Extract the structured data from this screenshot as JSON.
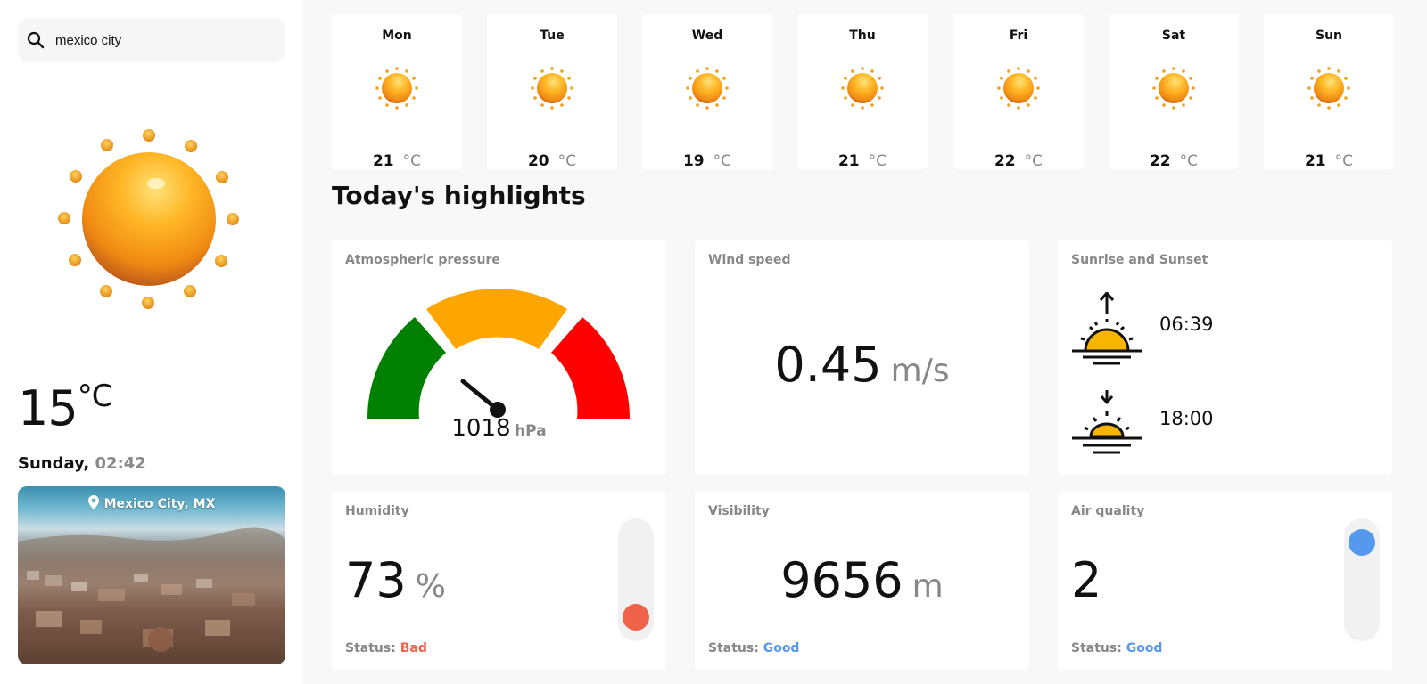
{
  "search": {
    "value": "mexico city",
    "icon": "search-icon"
  },
  "current": {
    "temperature": "15",
    "unit": "°C",
    "day": "Sunday,",
    "time": "02:42",
    "location": "Mexico City, MX",
    "icon": "sun-icon"
  },
  "forecast": [
    {
      "day": "Mon",
      "temp": "21",
      "unit": "°C",
      "icon": "sun-icon"
    },
    {
      "day": "Tue",
      "temp": "20",
      "unit": "°C",
      "icon": "sun-icon"
    },
    {
      "day": "Wed",
      "temp": "19",
      "unit": "°C",
      "icon": "sun-icon"
    },
    {
      "day": "Thu",
      "temp": "21",
      "unit": "°C",
      "icon": "sun-icon"
    },
    {
      "day": "Fri",
      "temp": "22",
      "unit": "°C",
      "icon": "sun-icon"
    },
    {
      "day": "Sat",
      "temp": "22",
      "unit": "°C",
      "icon": "sun-icon"
    },
    {
      "day": "Sun",
      "temp": "21",
      "unit": "°C",
      "icon": "sun-icon"
    }
  ],
  "highlights": {
    "title": "Today's highlights",
    "pressure": {
      "label": "Atmospheric pressure",
      "value": "1018",
      "unit": "hPa",
      "colors": [
        "#008000",
        "#ffa500",
        "#ff0000"
      ]
    },
    "wind": {
      "label": "Wind speed",
      "value": "0.45",
      "unit": "m/s"
    },
    "sun": {
      "label": "Sunrise and Sunset",
      "sunrise": "06:39",
      "sunset": "18:00",
      "sunrise_icon": "sunrise-icon",
      "sunset_icon": "sunset-icon"
    },
    "humidity": {
      "label": "Humidity",
      "value": "73",
      "unit": "%",
      "status_label": "Status:",
      "status": "Bad",
      "status_color": "#f0634a",
      "level": 0.0
    },
    "visibility": {
      "label": "Visibility",
      "value": "9656",
      "unit": "m",
      "status_label": "Status:",
      "status": "Good",
      "status_color": "#5599ee"
    },
    "air": {
      "label": "Air quality",
      "value": "2",
      "status_label": "Status:",
      "status": "Good",
      "status_color": "#5599ee",
      "level": 1.0
    }
  }
}
